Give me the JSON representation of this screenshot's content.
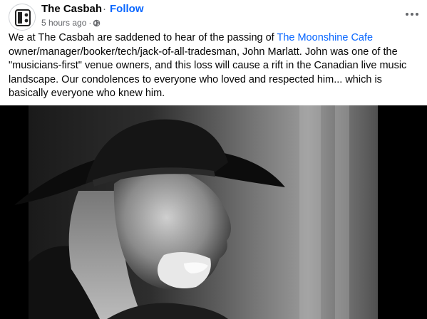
{
  "post": {
    "page_name": "The Casbah",
    "separator": "·",
    "follow_label": "Follow",
    "timestamp": "5 hours ago",
    "timestamp_separator": "·",
    "audience_icon": "globe-icon",
    "more_icon": "more-horizontal-icon",
    "text_part1": "We at The Casbah are saddened to hear of the passing of ",
    "link_text": "The Moonshine Cafe",
    "text_part2": " owner/manager/booker/tech/jack-of-all-tradesman, John Marlatt. John was one of the \"musicians-first\" venue owners, and this loss will cause a rift in the Canadian live music landscape. Our condolences to everyone who loved and respected him... which is basically everyone who knew him.",
    "image_subject": "black-and-white photo of a smiling man in a cowboy hat",
    "colors": {
      "link": "#0866ff",
      "secondary_text": "#65676b",
      "primary_text": "#050505"
    }
  }
}
